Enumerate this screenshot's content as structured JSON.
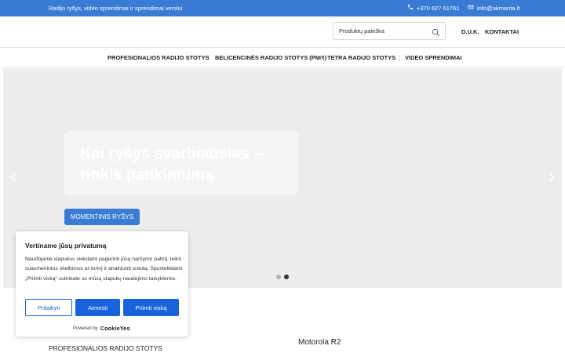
{
  "topbar": {
    "tagline": "Radijo ryšys, video sprendimai ir sprendimai verslui",
    "phone": "+370 627 61761",
    "email": "info@akmanta.lt",
    "background": "#3a7bd5"
  },
  "header": {
    "search_placeholder": "Produktų paieška",
    "links": {
      "faq": "D.U.K.",
      "contacts": "KONTAKTAI"
    }
  },
  "nav": {
    "items": [
      {
        "label": "PROFESIONALIOS RADIJO STOTYS"
      },
      {
        "label": "BELICENCINĖS RADIJO STOTYS (PMR)"
      },
      {
        "label": "TETRA RADIJO STOTYS"
      },
      {
        "label": "VIDEO SPRENDIMAI"
      }
    ]
  },
  "hero": {
    "headline": "Kai ryšys svarbiausias – rinkis patikimumą",
    "cta_label": "MOMENTINIS RYŠYS",
    "slides_total": 2,
    "active_slide": 2
  },
  "below": {
    "section_label": "PROFESIONALIOS RADIJO STOTYS",
    "product_name": "Motorola R2"
  },
  "cookie": {
    "title": "Vertiname jūsų privatumą",
    "text": "Naudojame slapukus siekdami pagerinti jūsų naršymo patirtį, teikti suasmenintus skelbimus ar turinį ir analizuoti srautą. Spustelėdami „Priimti viską“ sutinkate su mūsų slapukų naudojimo taisyklėmis.",
    "buttons": {
      "customize": "Pritaikyti",
      "reject": "Atmesti",
      "accept": "Priimti viską"
    },
    "powered_by": "Powered by",
    "brand": "CookieYes",
    "accent": "#1863dc"
  },
  "icons": {
    "phone": "phone-icon",
    "email": "envelope-icon",
    "search": "search-icon",
    "prev": "chevron-left-icon",
    "next": "chevron-right-icon"
  }
}
